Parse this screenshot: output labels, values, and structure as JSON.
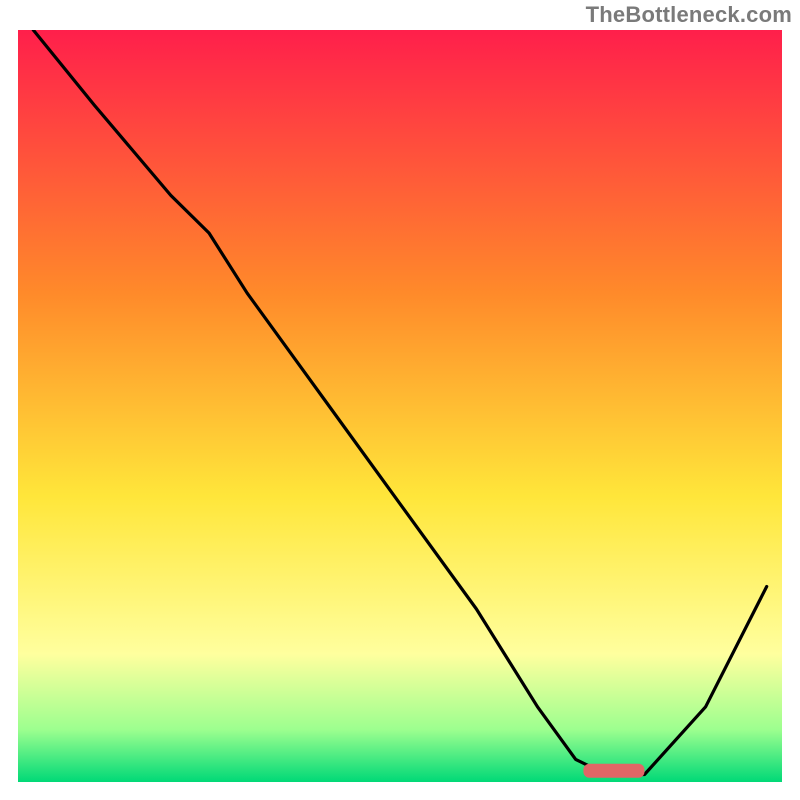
{
  "attribution": "TheBottleneck.com",
  "colors": {
    "curve_stroke": "#000000",
    "marker_fill": "#e06666",
    "gradient_top": "#ff1f4b",
    "gradient_mid1": "#ff8a2a",
    "gradient_mid2": "#ffe63a",
    "gradient_low": "#ffff9e",
    "gradient_green_light": "#9dff8f",
    "gradient_green": "#00d977"
  },
  "chart_data": {
    "type": "line",
    "title": "",
    "xlabel": "",
    "ylabel": "",
    "xlim": [
      0,
      100
    ],
    "ylim": [
      0,
      100
    ],
    "grid": false,
    "legend": false,
    "series": [
      {
        "name": "bottleneck-curve",
        "x": [
          2,
          10,
          20,
          25,
          30,
          40,
          50,
          60,
          68,
          73,
          77,
          82,
          90,
          98
        ],
        "y": [
          100,
          90,
          78,
          73,
          65,
          51,
          37,
          23,
          10,
          3,
          1,
          1,
          10,
          26
        ]
      }
    ],
    "marker": {
      "name": "optimal-range",
      "x_start": 74,
      "x_end": 82,
      "y": 1.5,
      "color": "#e06666"
    }
  }
}
